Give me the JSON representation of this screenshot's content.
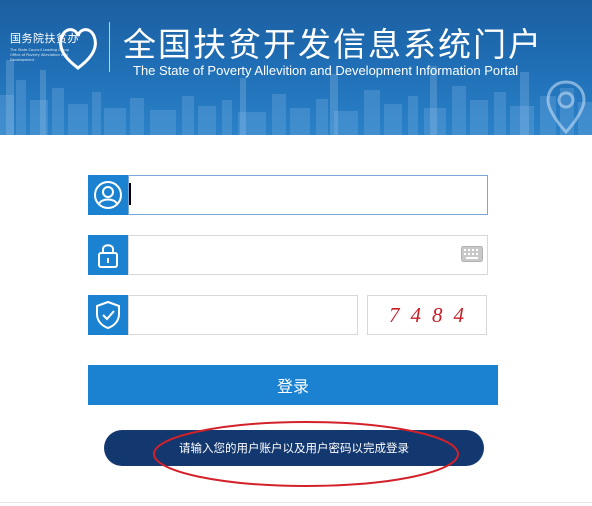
{
  "header": {
    "seal_cn": "国务院扶贫办",
    "seal_en_lines": [
      "The State Council Leading Group",
      "Office of Poverty Alleviation and",
      "Development"
    ],
    "title_cn": "全国扶贫开发信息系统门户",
    "title_en": "The State of Poverty Allevition and Development Information Portal"
  },
  "form": {
    "username": {
      "icon": "user-icon",
      "value": ""
    },
    "password": {
      "icon": "lock-icon",
      "value": "",
      "keyboard_icon": "keyboard-icon"
    },
    "captcha": {
      "icon": "shield-check-icon",
      "value": "",
      "code": "7484"
    },
    "login_label": "登录",
    "hint": "请输入您的用户账户以及用户密码以完成登录"
  },
  "colors": {
    "primary": "#1b82d1",
    "hint_bg": "#13386f",
    "captcha_text": "#c8202a",
    "annotation": "#d3212a"
  }
}
